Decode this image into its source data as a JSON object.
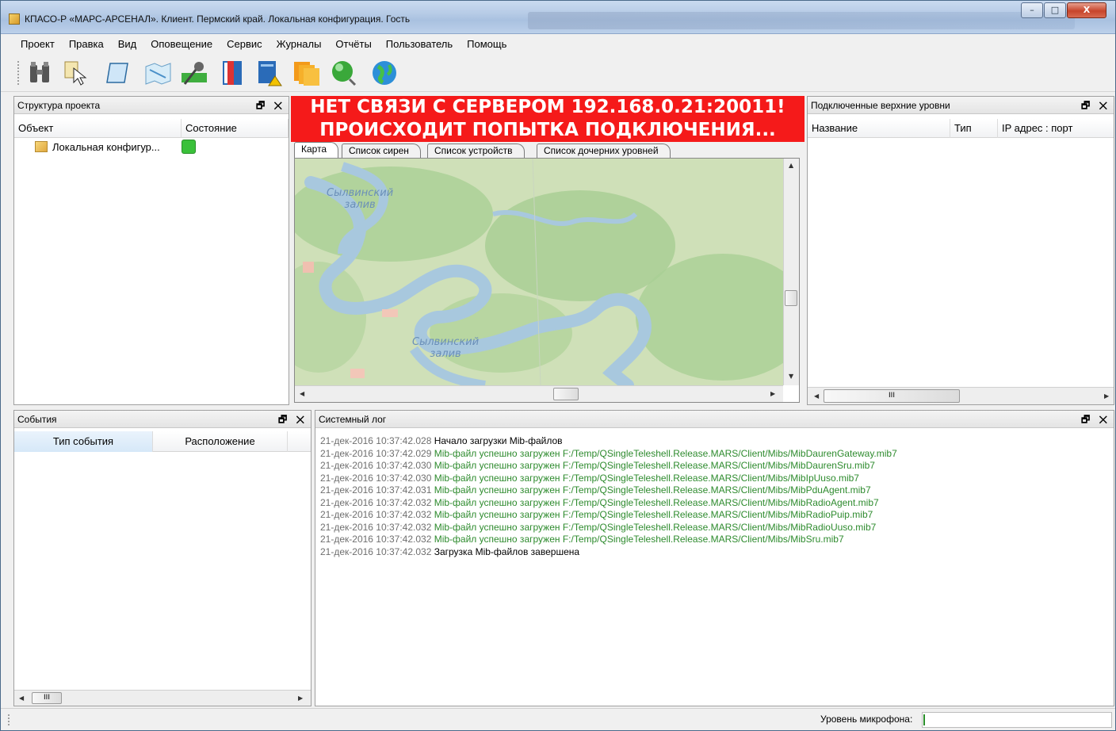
{
  "window": {
    "title": "КПАСО-Р «МАРС-АРСЕНАЛ». Клиент. Пермский край. Локальная конфигурация. Гость",
    "controls": {
      "minimize": "–",
      "maximize": "□",
      "close": "X"
    }
  },
  "menu": [
    "Проект",
    "Правка",
    "Вид",
    "Оповещение",
    "Сервис",
    "Журналы",
    "Отчёты",
    "Пользователь",
    "Помощь"
  ],
  "toolbar": {
    "icons": [
      "binoculars-icon",
      "select-cursor-icon",
      "scroll-icon",
      "map-area-icon",
      "microphone-icon",
      "book-icon",
      "warning-document-icon",
      "documents-icon",
      "green-sphere-icon",
      "globe-icon"
    ]
  },
  "project_panel": {
    "title": "Структура проекта",
    "controls": "🗗 ✕",
    "columns": [
      "Объект",
      "Состояние"
    ],
    "items": [
      {
        "label": "Локальная конфигур...",
        "status_color": "#3ac13a"
      }
    ]
  },
  "center": {
    "banner": {
      "line1": "НЕТ СВЯЗИ С СЕРВЕРОМ 192.168.0.21:20011!",
      "line2": "ПРОИСХОДИТ ПОПЫТКА ПОДКЛЮЧЕНИЯ...",
      "color": "#f51a1a"
    },
    "tabs": [
      "Карта",
      "Список сирен",
      "Список устройств",
      "Список дочерних уровней"
    ],
    "map_labels": [
      {
        "line1": "Сылвинский",
        "line2": "залив"
      },
      {
        "line1": "Сылвинский",
        "line2": "залив"
      }
    ]
  },
  "upper_panel": {
    "title": "Подключенные верхние уровни",
    "controls": "🗗 ✕",
    "columns": [
      "Название",
      "Тип",
      "IP адрес : порт"
    ],
    "scroll_mark": "III"
  },
  "events_panel": {
    "title": "События",
    "controls": "🗗 ✕",
    "columns": [
      "Тип события",
      "Расположение"
    ],
    "scroll_mark": "III"
  },
  "log_panel": {
    "title": "Системный лог",
    "controls": "🗗 ✕",
    "lines": [
      {
        "ts": "21-дек-2016 10:37:42.028",
        "msg": "Начало загрузки Mib-файлов",
        "kind": "black"
      },
      {
        "ts": "21-дек-2016 10:37:42.029",
        "msg": "Mib-файл успешно загружен F:/Temp/QSingleTeleshell.Release.MARS/Client/Mibs/MibDaurenGateway.mib7",
        "kind": "green"
      },
      {
        "ts": "21-дек-2016 10:37:42.030",
        "msg": "Mib-файл успешно загружен F:/Temp/QSingleTeleshell.Release.MARS/Client/Mibs/MibDaurenSru.mib7",
        "kind": "green"
      },
      {
        "ts": "21-дек-2016 10:37:42.030",
        "msg": "Mib-файл успешно загружен F:/Temp/QSingleTeleshell.Release.MARS/Client/Mibs/MibIpUuso.mib7",
        "kind": "green"
      },
      {
        "ts": "21-дек-2016 10:37:42.031",
        "msg": "Mib-файл успешно загружен F:/Temp/QSingleTeleshell.Release.MARS/Client/Mibs/MibPduAgent.mib7",
        "kind": "green"
      },
      {
        "ts": "21-дек-2016 10:37:42.032",
        "msg": "Mib-файл успешно загружен F:/Temp/QSingleTeleshell.Release.MARS/Client/Mibs/MibRadioAgent.mib7",
        "kind": "green"
      },
      {
        "ts": "21-дек-2016 10:37:42.032",
        "msg": "Mib-файл успешно загружен F:/Temp/QSingleTeleshell.Release.MARS/Client/Mibs/MibRadioPuip.mib7",
        "kind": "green"
      },
      {
        "ts": "21-дек-2016 10:37:42.032",
        "msg": "Mib-файл успешно загружен F:/Temp/QSingleTeleshell.Release.MARS/Client/Mibs/MibRadioUuso.mib7",
        "kind": "green"
      },
      {
        "ts": "21-дек-2016 10:37:42.032",
        "msg": "Mib-файл успешно загружен F:/Temp/QSingleTeleshell.Release.MARS/Client/Mibs/MibSru.mib7",
        "kind": "green"
      },
      {
        "ts": "21-дек-2016 10:37:42.032",
        "msg": "Загрузка Mib-файлов завершена",
        "kind": "black"
      }
    ]
  },
  "statusbar": {
    "mic_label": "Уровень микрофона:"
  }
}
